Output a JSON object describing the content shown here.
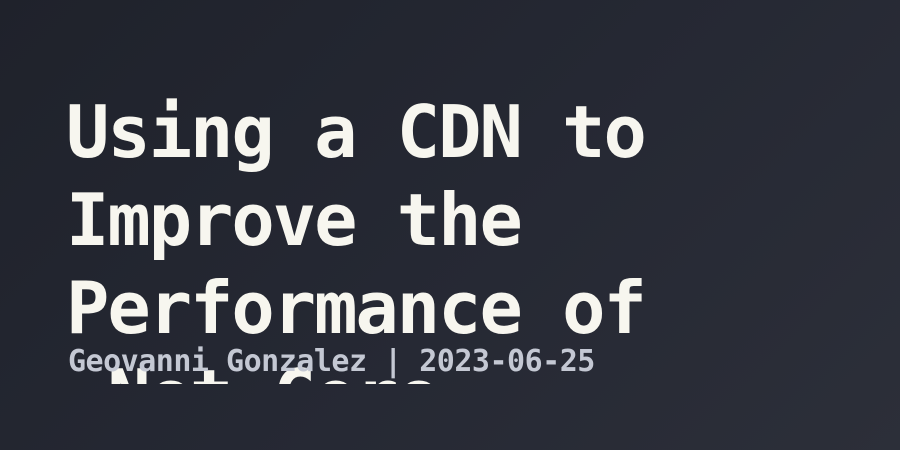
{
  "post": {
    "title": "Using a CDN to\nImprove the\nPerformance of\n.Net Core",
    "author": "Geovanni Gonzalez",
    "separator": "|",
    "date": "2023-06-25"
  }
}
